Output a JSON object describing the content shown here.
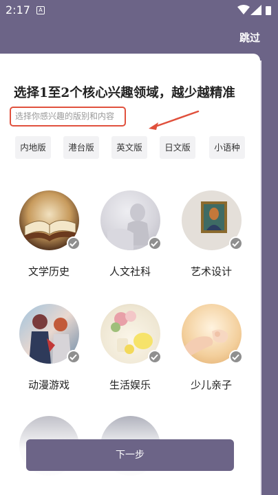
{
  "status_bar": {
    "time": "2:17",
    "notif_glyph": "A"
  },
  "header": {
    "skip_label": "跳过"
  },
  "card": {
    "title": "选择1至2个核心兴趣领域，越少越精准",
    "subtitle": "选择你感兴趣的版别和内容"
  },
  "tabs": [
    {
      "label": "内地版"
    },
    {
      "label": "港台版"
    },
    {
      "label": "英文版"
    },
    {
      "label": "日文版"
    },
    {
      "label": "小语种"
    }
  ],
  "interests": [
    {
      "label": "文学历史",
      "icon": "open-book-image"
    },
    {
      "label": "人文社科",
      "icon": "statue-image"
    },
    {
      "label": "艺术设计",
      "icon": "painting-image"
    },
    {
      "label": "动漫游戏",
      "icon": "anime-image"
    },
    {
      "label": "生活娱乐",
      "icon": "flowers-image"
    },
    {
      "label": "少儿亲子",
      "icon": "hands-image"
    }
  ],
  "footer": {
    "next_label": "下一步"
  },
  "colors": {
    "accent": "#6c6487",
    "highlight": "#e0503c",
    "check": "#8f8f8f"
  }
}
